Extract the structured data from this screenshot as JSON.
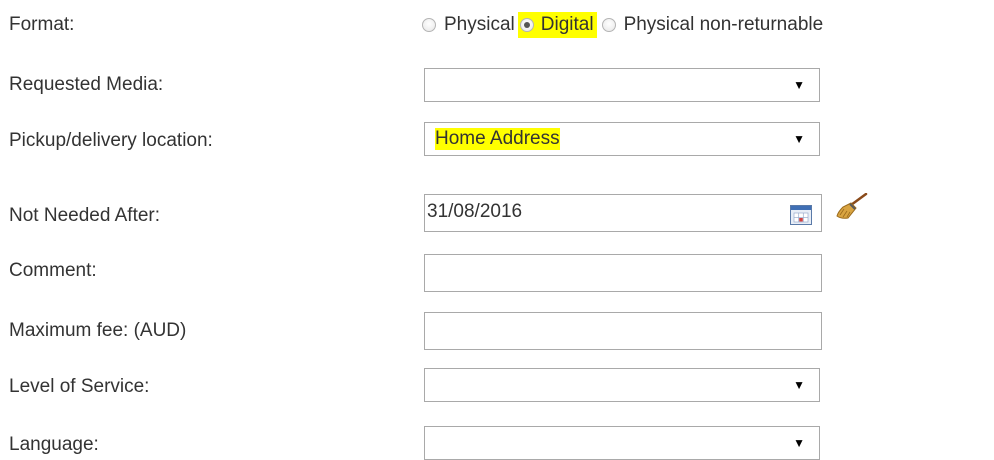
{
  "format": {
    "label": "Format:",
    "options": [
      {
        "label": "Physical",
        "checked": false
      },
      {
        "label": "Digital",
        "checked": true
      },
      {
        "label": "Physical non-returnable",
        "checked": false
      }
    ]
  },
  "requested_media": {
    "label": "Requested Media:",
    "value": ""
  },
  "pickup_location": {
    "label": "Pickup/delivery location:",
    "value": "Home Address"
  },
  "not_needed_after": {
    "label": "Not Needed After:",
    "value": "31/08/2016"
  },
  "comment": {
    "label": "Comment:",
    "value": ""
  },
  "maximum_fee": {
    "label": "Maximum fee: (AUD)",
    "value": ""
  },
  "level_of_service": {
    "label": "Level of Service:",
    "value": ""
  },
  "language": {
    "label": "Language:",
    "value": ""
  },
  "icons": {
    "dropdown_arrow": "▼",
    "calendar": "calendar-icon",
    "broom": "broom-icon"
  },
  "colors": {
    "highlight": "#ffff00",
    "border": "#a9a9a9",
    "text": "#333333"
  }
}
